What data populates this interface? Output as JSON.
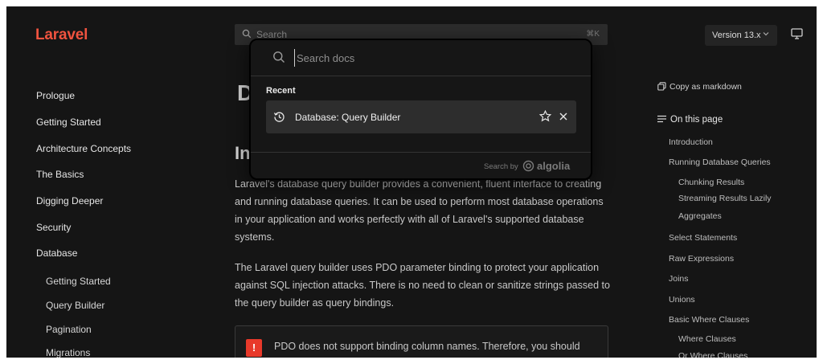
{
  "header": {
    "logo": "Laravel",
    "search_placeholder": "Search",
    "search_shortcut": "⌘K",
    "version_label": "Version 13.x"
  },
  "sidebar": {
    "items": [
      {
        "label": "Prologue"
      },
      {
        "label": "Getting Started"
      },
      {
        "label": "Architecture Concepts"
      },
      {
        "label": "The Basics"
      },
      {
        "label": "Digging Deeper"
      },
      {
        "label": "Security"
      },
      {
        "label": "Database"
      }
    ],
    "sub_items": [
      {
        "label": "Getting Started"
      },
      {
        "label": "Query Builder"
      },
      {
        "label": "Pagination"
      },
      {
        "label": "Migrations"
      }
    ]
  },
  "main": {
    "title": "D",
    "section_heading": "In",
    "paragraph1_lines": [
      "Laravel's database query builder provides a convenient, fluent interface to creating",
      "and running database queries. It can be used to perform most database operations",
      "in your application and works perfectly with all of Laravel's supported database",
      "systems."
    ],
    "paragraph2_lines": [
      "The Laravel query builder uses PDO parameter binding to protect your application",
      "against SQL injection attacks. There is no need to clean or sanitize strings passed to",
      "the query builder as query bindings."
    ],
    "callout_icon": "!",
    "callout_text": "PDO does not support binding column names. Therefore, you should"
  },
  "toc": {
    "copy_markdown": "Copy as markdown",
    "on_this_page": "On this page",
    "items": [
      {
        "label": "Introduction",
        "level": 1
      },
      {
        "label": "Running Database Queries",
        "level": 1
      },
      {
        "label": "Chunking Results",
        "level": 2
      },
      {
        "label": "Streaming Results Lazily",
        "level": 2
      },
      {
        "label": "Aggregates",
        "level": 2
      },
      {
        "label": "Select Statements",
        "level": 1
      },
      {
        "label": "Raw Expressions",
        "level": 1
      },
      {
        "label": "Joins",
        "level": 1
      },
      {
        "label": "Unions",
        "level": 1
      },
      {
        "label": "Basic Where Clauses",
        "level": 1
      },
      {
        "label": "Where Clauses",
        "level": 2
      },
      {
        "label": "Or Where Clauses",
        "level": 2
      }
    ]
  },
  "search_modal": {
    "placeholder": "Search docs",
    "recent_label": "Recent",
    "recent_hit": "Database: Query Builder",
    "search_by": "Search by",
    "provider": "algolia"
  },
  "colors": {
    "brand": "#f0533f",
    "background": "#151515",
    "warning": "#e8392a"
  },
  "icons": [
    "search-icon",
    "chevron-down-icon",
    "monitor-icon",
    "copy-icon",
    "list-icon",
    "history-icon",
    "star-icon",
    "close-icon",
    "algolia-icon"
  ]
}
